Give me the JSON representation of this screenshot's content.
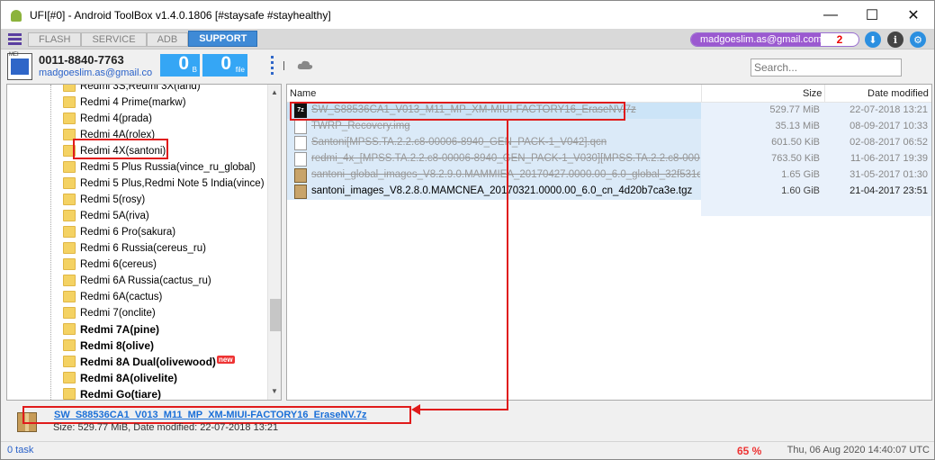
{
  "window": {
    "title": "UFI[#0] - Android ToolBox v1.4.0.1806 [#staysafe #stayhealthy]",
    "minimize": "—",
    "maximize": "☐",
    "close": "✕"
  },
  "toolbar": {
    "tabs": [
      {
        "label": "FLASH",
        "active": false
      },
      {
        "label": "SERVICE",
        "active": false
      },
      {
        "label": "ADB",
        "active": false
      },
      {
        "label": "SUPPORT",
        "active": true
      }
    ],
    "account_email": "madgoeslim.as@gmail.com",
    "account_count": "2"
  },
  "device": {
    "icon_label": "MEI",
    "phone": "0011-8840-7763",
    "email": "madgoeslim.as@gmail.co",
    "bytes_value": "0",
    "bytes_unit": "B",
    "files_value": "0",
    "files_unit": "file"
  },
  "search": {
    "placeholder": "Search..."
  },
  "tree": {
    "items": [
      {
        "label": "Redmi 3S,Redmi 3X(land)",
        "bold": false
      },
      {
        "label": "Redmi 4 Prime(markw)",
        "bold": false
      },
      {
        "label": "Redmi 4(prada)",
        "bold": false
      },
      {
        "label": "Redmi 4A(rolex)",
        "bold": false
      },
      {
        "label": "Redmi 4X(santoni)",
        "bold": false
      },
      {
        "label": "Redmi 5 Plus Russia(vince_ru_global)",
        "bold": false
      },
      {
        "label": "Redmi 5 Plus,Redmi Note 5 India(vince)",
        "bold": false
      },
      {
        "label": "Redmi 5(rosy)",
        "bold": false
      },
      {
        "label": "Redmi 5A(riva)",
        "bold": false
      },
      {
        "label": "Redmi 6 Pro(sakura)",
        "bold": false
      },
      {
        "label": "Redmi 6 Russia(cereus_ru)",
        "bold": false
      },
      {
        "label": "Redmi 6(cereus)",
        "bold": false
      },
      {
        "label": "Redmi 6A Russia(cactus_ru)",
        "bold": false
      },
      {
        "label": "Redmi 6A(cactus)",
        "bold": false
      },
      {
        "label": "Redmi 7(onclite)",
        "bold": false
      },
      {
        "label": "Redmi 7A(pine)",
        "bold": true
      },
      {
        "label": "Redmi 8(olive)",
        "bold": true
      },
      {
        "label": "Redmi 8A Dual(olivewood)",
        "bold": true,
        "badge": "new"
      },
      {
        "label": "Redmi 8A(olivelite)",
        "bold": true
      },
      {
        "label": "Redmi Go(tiare)",
        "bold": true
      }
    ]
  },
  "list": {
    "headers": {
      "name": "Name",
      "size": "Size",
      "date": "Date modified"
    },
    "rows": [
      {
        "name": "SW_S88536CA1_V013_M11_MP_XM-MIUI-FACTORY16_EraseNV.7z",
        "size": "529.77 MiB",
        "date": "22-07-2018 13:21",
        "icon": "7z",
        "strike": true,
        "icon_label": "7z"
      },
      {
        "name": "TWRP_Recovery.img",
        "size": "35.13 MiB",
        "date": "08-09-2017 10:33",
        "icon": "file",
        "strike": true
      },
      {
        "name": "Santoni[MPSS.TA.2.2.c8-00006-8940_GEN_PACK-1_V042].qcn",
        "size": "601.50 KiB",
        "date": "02-08-2017 06:52",
        "icon": "file",
        "strike": true
      },
      {
        "name": "redmi_4x_[MPSS.TA.2.2.c8-00006-8940_GEN_PACK-1_V030][MPSS.TA.2.2.c8-00006-…",
        "size": "763.50 KiB",
        "date": "11-06-2017 19:39",
        "icon": "file",
        "strike": true
      },
      {
        "name": "santoni_global_images_V8.2.9.0.MAMMIEA_20170427.0000.00_6.0_global_32f531d3c…",
        "size": "1.65 GiB",
        "date": "31-05-2017 01:30",
        "icon": "box",
        "strike": true
      },
      {
        "name": "santoni_images_V8.2.8.0.MAMCNEA_20170321.0000.00_6.0_cn_4d20b7ca3e.tgz",
        "size": "1.60 GiB",
        "date": "21-04-2017 23:51",
        "icon": "box",
        "strike": false
      }
    ]
  },
  "details": {
    "name": "SW_S88536CA1_V013_M11_MP_XM-MIUI-FACTORY16_EraseNV.7z",
    "meta": "Size: 529.77 MiB, Date modified: 22-07-2018 13:21"
  },
  "status": {
    "tasks": "0 task",
    "percent": "65 %",
    "clock": "Thu, 06 Aug 2020 14:40:07 UTC"
  }
}
